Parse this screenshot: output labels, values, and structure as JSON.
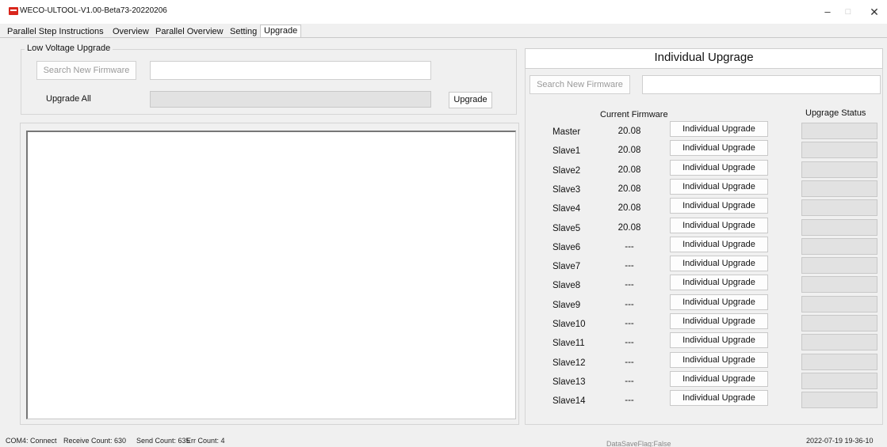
{
  "window": {
    "title": "WECO-ULTOOL-V1.00-Beta73-20220206",
    "min_glyph": "–",
    "max_glyph": "□",
    "close_glyph": "✕"
  },
  "tabs": [
    {
      "label": "Parallel Step Instructions",
      "active": false
    },
    {
      "label": "Overview",
      "active": false
    },
    {
      "label": "Parallel Overview",
      "active": false
    },
    {
      "label": "Setting",
      "active": false
    },
    {
      "label": "Upgrade",
      "active": true
    }
  ],
  "low_voltage": {
    "group_title": "Low Voltage Upgrade",
    "search_button": "Search New Firmware",
    "path_value": "",
    "upgrade_all_label": "Upgrade All",
    "upgrade_button": "Upgrade",
    "progress": 0
  },
  "log": {
    "content": ""
  },
  "individual": {
    "title": "Individual Upgrage",
    "search_button": "Search New Firmware",
    "path_value": "",
    "current_firmware_header": "Current Firmware",
    "status_header": "Upgrage Status",
    "upgrade_button_label": "Individual Upgrade",
    "devices": [
      {
        "name": "Master",
        "firmware": "20.08",
        "progress": 0
      },
      {
        "name": "Slave1",
        "firmware": "20.08",
        "progress": 0
      },
      {
        "name": "Slave2",
        "firmware": "20.08",
        "progress": 0
      },
      {
        "name": "Slave3",
        "firmware": "20.08",
        "progress": 0
      },
      {
        "name": "Slave4",
        "firmware": "20.08",
        "progress": 0
      },
      {
        "name": "Slave5",
        "firmware": "20.08",
        "progress": 0
      },
      {
        "name": "Slave6",
        "firmware": "---",
        "progress": 0
      },
      {
        "name": "Slave7",
        "firmware": "---",
        "progress": 0
      },
      {
        "name": "Slave8",
        "firmware": "---",
        "progress": 0
      },
      {
        "name": "Slave9",
        "firmware": "---",
        "progress": 0
      },
      {
        "name": "Slave10",
        "firmware": "---",
        "progress": 0
      },
      {
        "name": "Slave11",
        "firmware": "---",
        "progress": 0
      },
      {
        "name": "Slave12",
        "firmware": "---",
        "progress": 0
      },
      {
        "name": "Slave13",
        "firmware": "---",
        "progress": 0
      },
      {
        "name": "Slave14",
        "firmware": "---",
        "progress": 0
      }
    ]
  },
  "status_bar": {
    "connection": "COM4: Connect",
    "receive_count": "Receive Count: 630",
    "send_count": "Send Count: 635",
    "err_count": "Err Count: 4",
    "save_flag": "DataSaveFlag:False",
    "timestamp": "2022-07-19 19-36-10"
  },
  "colors": {
    "app_icon": "#d9261c",
    "window_bg": "#f0f0f0",
    "progress_empty": "#e2e2e2"
  }
}
